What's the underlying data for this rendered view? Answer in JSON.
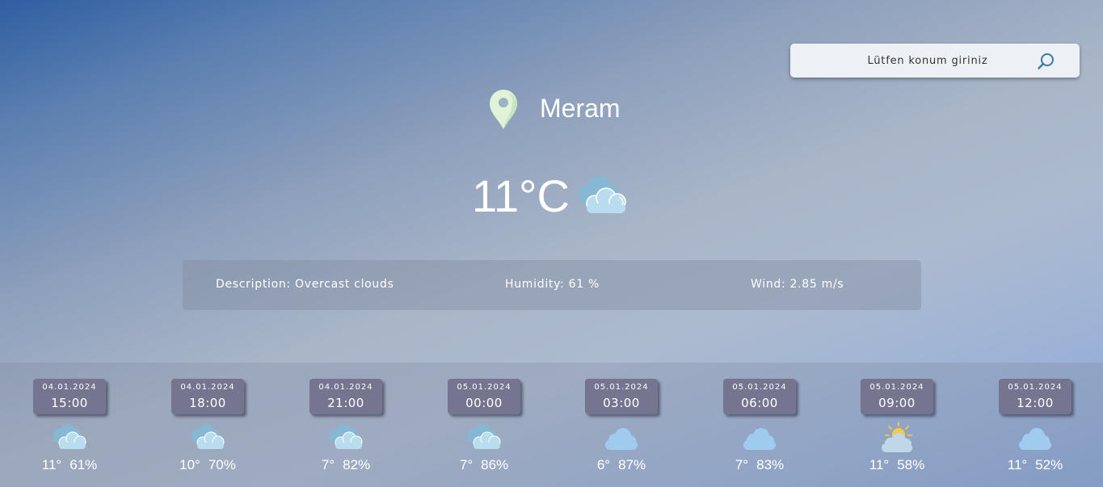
{
  "search": {
    "placeholder": "Lütfen konum giriniz",
    "icon": "search-icon"
  },
  "location": {
    "city": "Meram",
    "icon": "map-pin-icon",
    "pin_color": "#dff3d6"
  },
  "current": {
    "temperature": "11°C",
    "icon": "overcast-clouds-icon"
  },
  "details": {
    "description": "Description: Overcast clouds",
    "humidity": "Humidity: 61 %",
    "wind": "Wind: 2.85 m/s"
  },
  "forecast": [
    {
      "date": "04.01.2024",
      "time": "15:00",
      "temp": "11°",
      "humidity": "61%",
      "icon": "overcast-clouds"
    },
    {
      "date": "04.01.2024",
      "time": "18:00",
      "temp": "10°",
      "humidity": "70%",
      "icon": "overcast-clouds"
    },
    {
      "date": "04.01.2024",
      "time": "21:00",
      "temp": "7°",
      "humidity": "82%",
      "icon": "overcast-clouds"
    },
    {
      "date": "05.01.2024",
      "time": "00:00",
      "temp": "7°",
      "humidity": "86%",
      "icon": "overcast-clouds"
    },
    {
      "date": "05.01.2024",
      "time": "03:00",
      "temp": "6°",
      "humidity": "87%",
      "icon": "cloud"
    },
    {
      "date": "05.01.2024",
      "time": "06:00",
      "temp": "7°",
      "humidity": "83%",
      "icon": "cloud"
    },
    {
      "date": "05.01.2024",
      "time": "09:00",
      "temp": "11°",
      "humidity": "58%",
      "icon": "sun-behind-cloud"
    },
    {
      "date": "05.01.2024",
      "time": "12:00",
      "temp": "11°",
      "humidity": "52%",
      "icon": "cloud"
    }
  ]
}
